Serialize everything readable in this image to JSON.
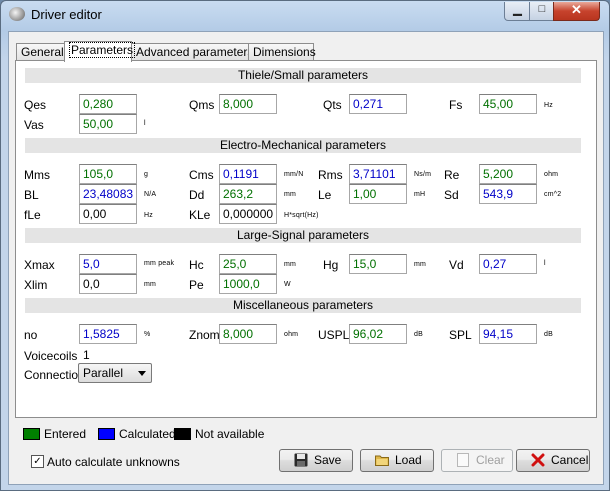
{
  "window": {
    "title": "Driver editor"
  },
  "tabs": [
    "General",
    "Parameters",
    "Advanced parameters",
    "Dimensions"
  ],
  "sections": {
    "ts": "Thiele/Small parameters",
    "em": "Electro-Mechanical parameters",
    "ls": "Large-Signal parameters",
    "misc": "Miscellaneous parameters"
  },
  "ts": {
    "qes": {
      "label": "Qes",
      "value": "0,280",
      "state": "entered"
    },
    "qms": {
      "label": "Qms",
      "value": "8,000",
      "state": "entered"
    },
    "qts": {
      "label": "Qts",
      "value": "0,271",
      "state": "calculated"
    },
    "fs": {
      "label": "Fs",
      "value": "45,00",
      "unit": "Hz",
      "state": "entered"
    },
    "vas": {
      "label": "Vas",
      "value": "50,00",
      "unit": "l",
      "state": "entered"
    }
  },
  "em": {
    "mms": {
      "label": "Mms",
      "value": "105,0",
      "unit": "g",
      "state": "entered"
    },
    "cms": {
      "label": "Cms",
      "value": "0,1191",
      "unit": "mm/N",
      "state": "calculated"
    },
    "rms": {
      "label": "Rms",
      "value": "3,71101",
      "unit": "Ns/m",
      "state": "calculated"
    },
    "re": {
      "label": "Re",
      "value": "5,200",
      "unit": "ohm",
      "state": "entered"
    },
    "bl": {
      "label": "BL",
      "value": "23,48083",
      "unit": "N/A",
      "state": "calculated"
    },
    "dd": {
      "label": "Dd",
      "value": "263,2",
      "unit": "mm",
      "state": "entered"
    },
    "le": {
      "label": "Le",
      "value": "1,00",
      "unit": "mH",
      "state": "entered"
    },
    "sd": {
      "label": "Sd",
      "value": "543,9",
      "unit": "cm^2",
      "state": "calculated"
    },
    "fle": {
      "label": "fLe",
      "value": "0,00",
      "unit": "Hz",
      "state": "na"
    },
    "kle": {
      "label": "KLe",
      "value": "0,000000",
      "unit": "H*sqrt(Hz)",
      "state": "na"
    }
  },
  "ls": {
    "xmax": {
      "label": "Xmax",
      "value": "5,0",
      "unit": "mm peak",
      "state": "calculated"
    },
    "hc": {
      "label": "Hc",
      "value": "25,0",
      "unit": "mm",
      "state": "entered"
    },
    "hg": {
      "label": "Hg",
      "value": "15,0",
      "unit": "mm",
      "state": "entered"
    },
    "vd": {
      "label": "Vd",
      "value": "0,27",
      "unit": "l",
      "state": "calculated"
    },
    "xlim": {
      "label": "Xlim",
      "value": "0,0",
      "unit": "mm",
      "state": "na"
    },
    "pe": {
      "label": "Pe",
      "value": "1000,0",
      "unit": "W",
      "state": "entered"
    }
  },
  "misc": {
    "no": {
      "label": "no",
      "value": "1,5825",
      "unit": "%",
      "state": "calculated"
    },
    "znom": {
      "label": "Znom",
      "value": "8,000",
      "unit": "ohm",
      "state": "entered"
    },
    "uspl": {
      "label": "USPL",
      "value": "96,02",
      "unit": "dB",
      "state": "entered"
    },
    "spl": {
      "label": "SPL",
      "value": "94,15",
      "unit": "dB",
      "state": "calculated"
    },
    "voicecoils": {
      "label": "Voicecoils",
      "value": "1"
    },
    "connection": {
      "label": "Connection",
      "value": "Parallel"
    }
  },
  "legend": {
    "entered": "Entered",
    "calculated": "Calculated",
    "na": "Not available",
    "colors": {
      "entered": "#008000",
      "calculated": "#0000ff",
      "na": "#000000"
    }
  },
  "auto_calc": {
    "label": "Auto calculate unknowns",
    "checked": true
  },
  "buttons": {
    "save": "Save",
    "load": "Load",
    "clear": "Clear",
    "cancel": "Cancel"
  }
}
